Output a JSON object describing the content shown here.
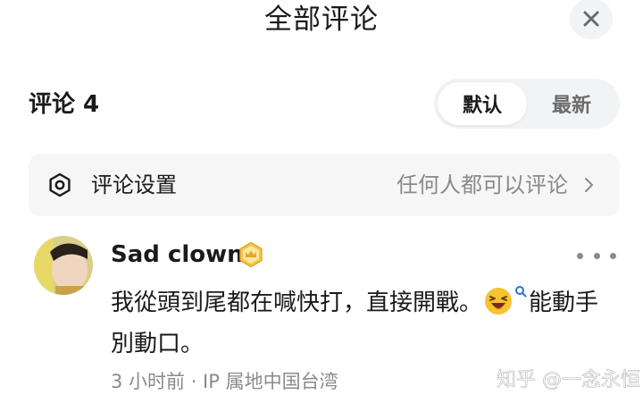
{
  "header": {
    "title": "全部评论"
  },
  "comments": {
    "heading": "评论 4",
    "sort": {
      "default_label": "默认",
      "newest_label": "最新",
      "selected": "默认"
    }
  },
  "settings": {
    "label": "评论设置",
    "value": "任何人都可以评论",
    "icon": "hexagon-settings-icon"
  },
  "comment": {
    "username": "Sad clown",
    "badge_icon": "crown-badge-icon",
    "text_before_emoji": "我從頭到尾都在喊快打，直接開戰。",
    "emoji_icon": "laughing-face-emoji-icon",
    "text_after_emoji": "能動手別動口。",
    "meta": "3 小时前 · IP 属地中国台湾"
  },
  "watermark": {
    "text": "知乎 @一念永恒"
  },
  "colors": {
    "badge": "#e3a82a",
    "muted": "#8a8a8a",
    "surface": "#f2f3f5"
  }
}
